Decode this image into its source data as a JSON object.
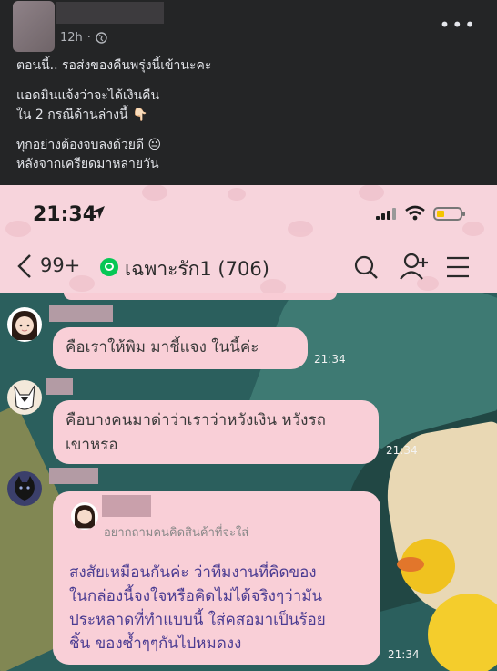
{
  "post": {
    "time": "12h",
    "paragraphs": [
      [
        "ตอนนี้.. รอส่งของคืนพรุ่งนี้เข้านะคะ"
      ],
      [
        "แอดมินแจ้งว่าจะได้เงินคืน",
        "ใน 2 กรณีด้านล่างนี้ 👇🏻"
      ],
      [
        "ทุกอย่างต้องจบลงด้วยดี 😐",
        "หลังจากเครียดมาหลายวัน"
      ]
    ]
  },
  "phone": {
    "time": "21:34",
    "unread": "99+",
    "group_name": "เฉพาะรัก1 (706)"
  },
  "messages": {
    "m1": {
      "text": "คือเราให้พิม มาชี้แจง ในนี้ค่ะ",
      "time": "21:34"
    },
    "m2": {
      "text1": "คือบางคนมาด่าว่าเราว่าหวังเงิน หวังรถ",
      "text2": "เขาหรอ",
      "time": "21:34"
    },
    "m3": {
      "quote": "อยากถามคนคิดสินค้าที่จะใส่",
      "lines": [
        "สงสัยเหมือนกันค่ะ ว่าทีมงานที่คิดของ",
        "ในกล่องนี้จงใจหรือคิดไม่ได้จริงๆว่ามัน",
        "ประหลาดที่ทำแบบนี้ ใส่คสอมาเป็นร้อย",
        "ชิ้น ของซ้ำๆๆกันไปหมดงง"
      ],
      "time": "21:34"
    }
  },
  "colors": {
    "fb_bg": "#242526",
    "line_pink": "#f7d4dc",
    "bubble": "#f9cfd7"
  }
}
